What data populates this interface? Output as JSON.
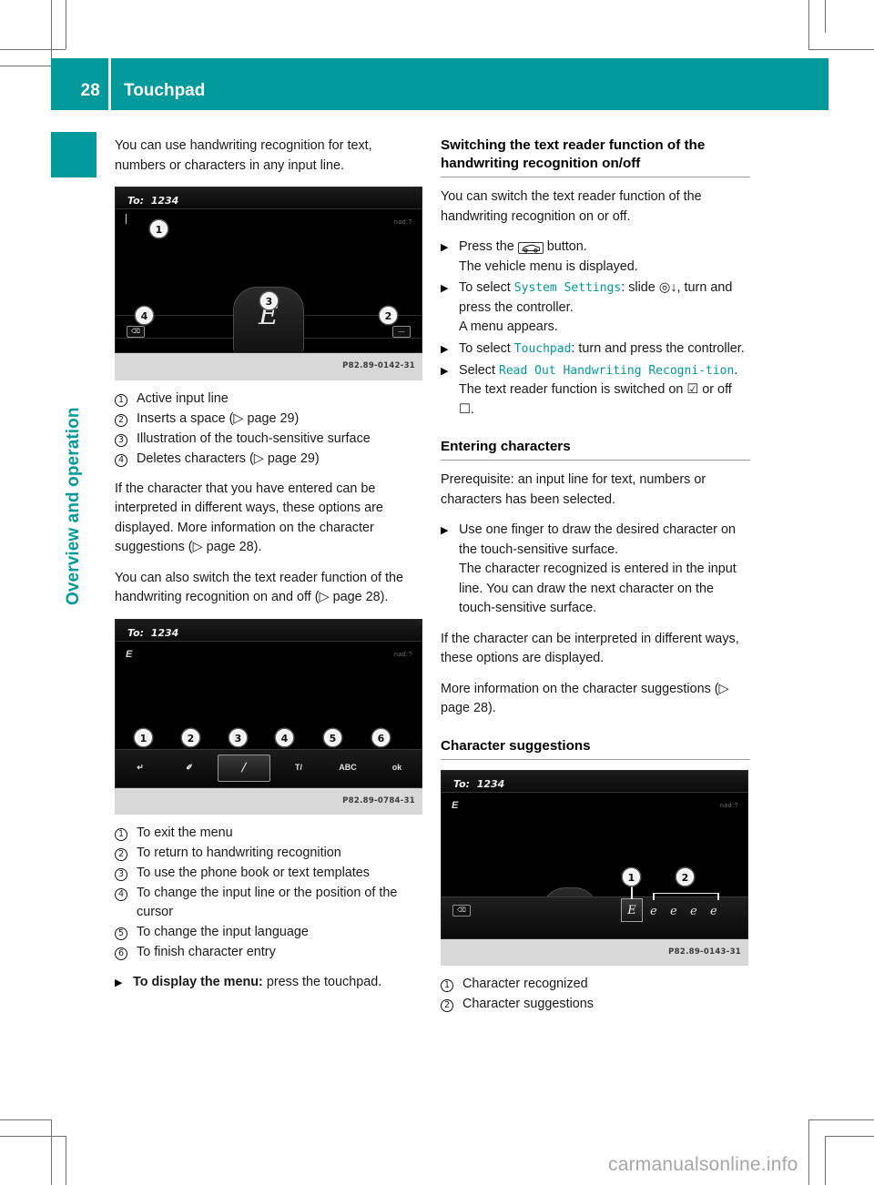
{
  "header": {
    "page_number": "28",
    "title": "Touchpad",
    "accent_color": "#009a9c"
  },
  "chapter_tab": {
    "label": "Overview and operation"
  },
  "left_column": {
    "intro": "You can use handwriting recognition for text, numbers or characters in any input line.",
    "figure1": {
      "screen_to_label": "To:",
      "screen_to_value": "1234",
      "screen_status": "nad:?",
      "pad_character": "E",
      "caption": "P82.89-0142-31",
      "callouts": [
        "1",
        "2",
        "3",
        "4"
      ]
    },
    "legend1": [
      {
        "num": "1",
        "text": "Active input line"
      },
      {
        "num": "2",
        "text": "Inserts a space (▷ page 29)"
      },
      {
        "num": "3",
        "text": "Illustration of the touch-sensitive surface"
      },
      {
        "num": "4",
        "text": "Deletes characters (▷ page 29)"
      }
    ],
    "para1": "If the character that you have entered can be interpreted in different ways, these options are displayed. More information on the character suggestions (▷ page 28).",
    "para2": "You can also switch the text reader function of the handwriting recognition on and off (▷ page 28).",
    "figure2": {
      "screen_to_label": "To:",
      "screen_to_value": "1234",
      "screen_status": "nad:?",
      "input_char": "E",
      "caption": "P82.89-0784-31",
      "menu_icons": [
        "↵",
        "✐",
        "╱",
        "T/",
        "ABC",
        "ok"
      ],
      "callouts": [
        "1",
        "2",
        "3",
        "4",
        "5",
        "6"
      ]
    },
    "legend2": [
      {
        "num": "1",
        "text": "To exit the menu"
      },
      {
        "num": "2",
        "text": "To return to handwriting recognition"
      },
      {
        "num": "3",
        "text": "To use the phone book or text templates"
      },
      {
        "num": "4",
        "text": "To change the input line or the position of the cursor"
      },
      {
        "num": "5",
        "text": "To change the input language"
      },
      {
        "num": "6",
        "text": "To finish character entry"
      }
    ],
    "final_step_bold": "To display the menu:",
    "final_step_rest": " press the touchpad."
  },
  "right_column": {
    "heading1": "Switching the text reader function of the handwriting recognition on/off",
    "para1": "You can switch the text reader function of the handwriting recognition on or off.",
    "steps1": [
      {
        "lead": "Press the ",
        "icon": "vehicle-button-icon",
        "tail": " button.",
        "sub": "The vehicle menu is displayed."
      },
      {
        "lead": "To select ",
        "ui": "System Settings",
        "tail": ": slide ◎↓, turn and press the controller.",
        "sub": "A menu appears."
      },
      {
        "lead": "To select ",
        "ui": "Touchpad",
        "tail": ": turn and press the controller.",
        "sub": ""
      },
      {
        "lead": "Select ",
        "ui": "Read Out Handwriting Recogni‐tion",
        "tail": ".",
        "sub": "The text reader function is switched on ☑ or off ☐."
      }
    ],
    "heading2": "Entering characters",
    "para2": "Prerequisite: an input line for text, numbers or characters has been selected.",
    "steps2": [
      {
        "lead": "Use one finger to draw the desired character on the touch-sensitive surface.",
        "sub": "The character recognized is entered in the input line. You can draw the next character on the touch-sensitive surface."
      }
    ],
    "para3": "If the character can be interpreted in different ways, these options are displayed.",
    "para4": "More information on the character suggestions (▷ page 28).",
    "heading3": "Character suggestions",
    "figure3": {
      "screen_to_label": "To:",
      "screen_to_value": "1234",
      "screen_status": "nad:?",
      "input_char": "E",
      "recognized_char": "E",
      "suggestions": [
        "e",
        "e",
        "e",
        "e"
      ],
      "caption": "P82.89-0143-31",
      "callouts": [
        "1",
        "2"
      ]
    },
    "legend3": [
      {
        "num": "1",
        "text": "Character recognized"
      },
      {
        "num": "2",
        "text": "Character suggestions"
      }
    ]
  },
  "watermark": "carmanualsonline.info"
}
